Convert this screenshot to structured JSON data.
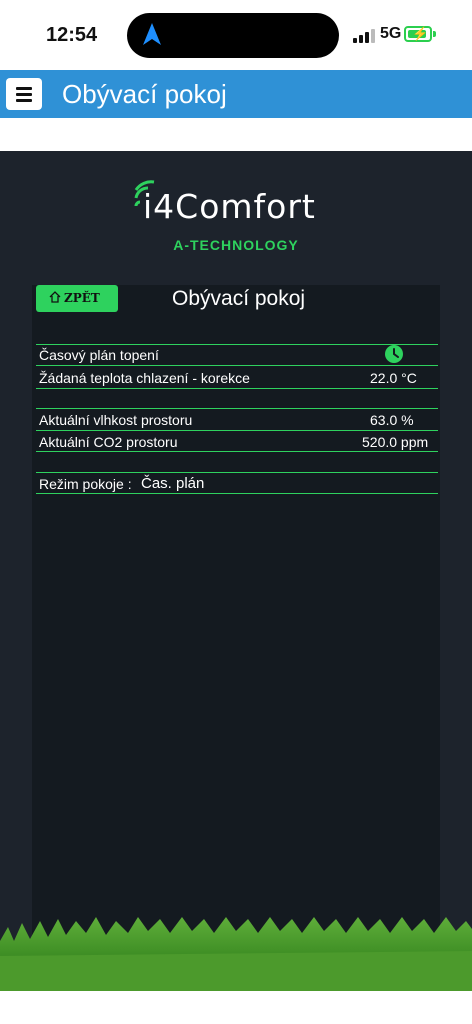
{
  "status_bar": {
    "time": "12:54",
    "network": "5G"
  },
  "header": {
    "title": "Obývací pokoj",
    "menu_icon": "hamburger-menu-icon"
  },
  "brand": {
    "name": "i4Comfort",
    "subtitle": "A-TECHNOLOGY",
    "accent": "#2ed25e"
  },
  "room": {
    "back_label": "ZPĚT",
    "title": "Obývací pokoj",
    "rows": [
      {
        "label": "Časový plán topení",
        "value_icon": "clock-icon"
      },
      {
        "label": "Žádaná teplota chlazení - korekce",
        "value": "22.0 °C"
      },
      {
        "label": "Aktuální vlhkost prostoru",
        "value": "63.0 %"
      },
      {
        "label": "Aktuální CO2 prostoru",
        "value": "520.0 ppm"
      },
      {
        "label": "Režim pokoje :",
        "value": "Čas. plán"
      }
    ]
  },
  "colors": {
    "header_blue": "#2f91d6",
    "panel_dark": "#1d232c",
    "card_dark": "#141a20",
    "green": "#2ed25e"
  }
}
